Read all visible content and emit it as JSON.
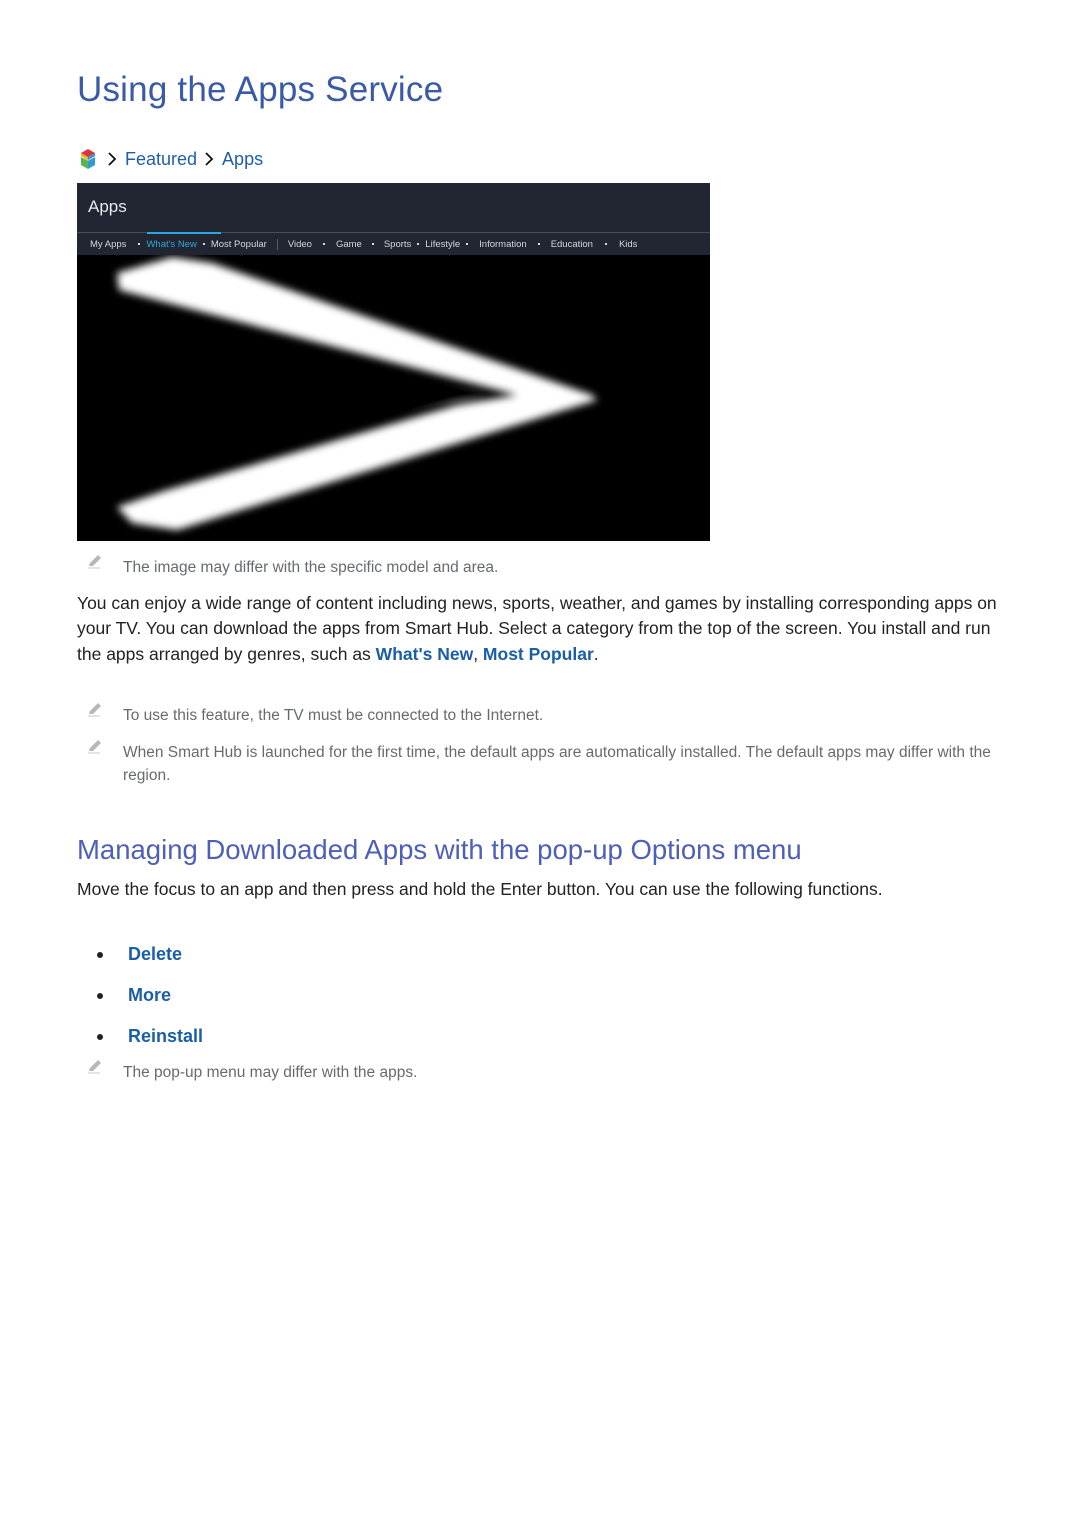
{
  "page": {
    "title": "Using the Apps Service",
    "breadcrumb": {
      "home_icon": "smart-hub-icon",
      "items": [
        "Featured",
        "Apps"
      ]
    },
    "tv_screen": {
      "header_title": "Apps",
      "tabs": [
        {
          "label": "My Apps",
          "active": false
        },
        {
          "label": "What's New",
          "active": true
        },
        {
          "label": "Most Popular",
          "active": false
        },
        {
          "label": "Video",
          "active": false
        },
        {
          "label": "Game",
          "active": false
        },
        {
          "label": "Sports",
          "active": false
        },
        {
          "label": "Lifestyle",
          "active": false
        },
        {
          "label": "Information",
          "active": false
        },
        {
          "label": "Education",
          "active": false
        },
        {
          "label": "Kids",
          "active": false
        }
      ],
      "content_image": "pixelated-chevron-right-icon",
      "accent_color": "#29a9d9"
    },
    "image_note": "The image may differ with the specific model and area.",
    "intro": {
      "text_before": "You can enjoy a wide range of content including news, sports, weather, and games by installing corresponding apps on your TV. You can download the apps from Smart Hub. Select a category from the top of the screen. You install and run the apps arranged by genres, such as ",
      "link1": "What's New",
      "between": ", ",
      "link2": "Most Popular",
      "text_after": "."
    },
    "notes": [
      "To use this feature, the TV must be connected to the Internet.",
      "When Smart Hub is launched for the first time, the default apps are automatically installed. The default apps may differ with the region."
    ],
    "section2": {
      "heading": "Managing Downloaded Apps with the pop-up Options menu",
      "body": "Move the focus to an app and then press and hold the Enter button. You can use the following functions.",
      "options": [
        "Delete",
        "More",
        "Reinstall"
      ],
      "note": "The pop-up menu may differ with the apps."
    },
    "colors": {
      "title": "#3a5aa8",
      "link": "#1a5ea8",
      "heading2": "#4d5fb8",
      "note": "#666b6f"
    }
  }
}
